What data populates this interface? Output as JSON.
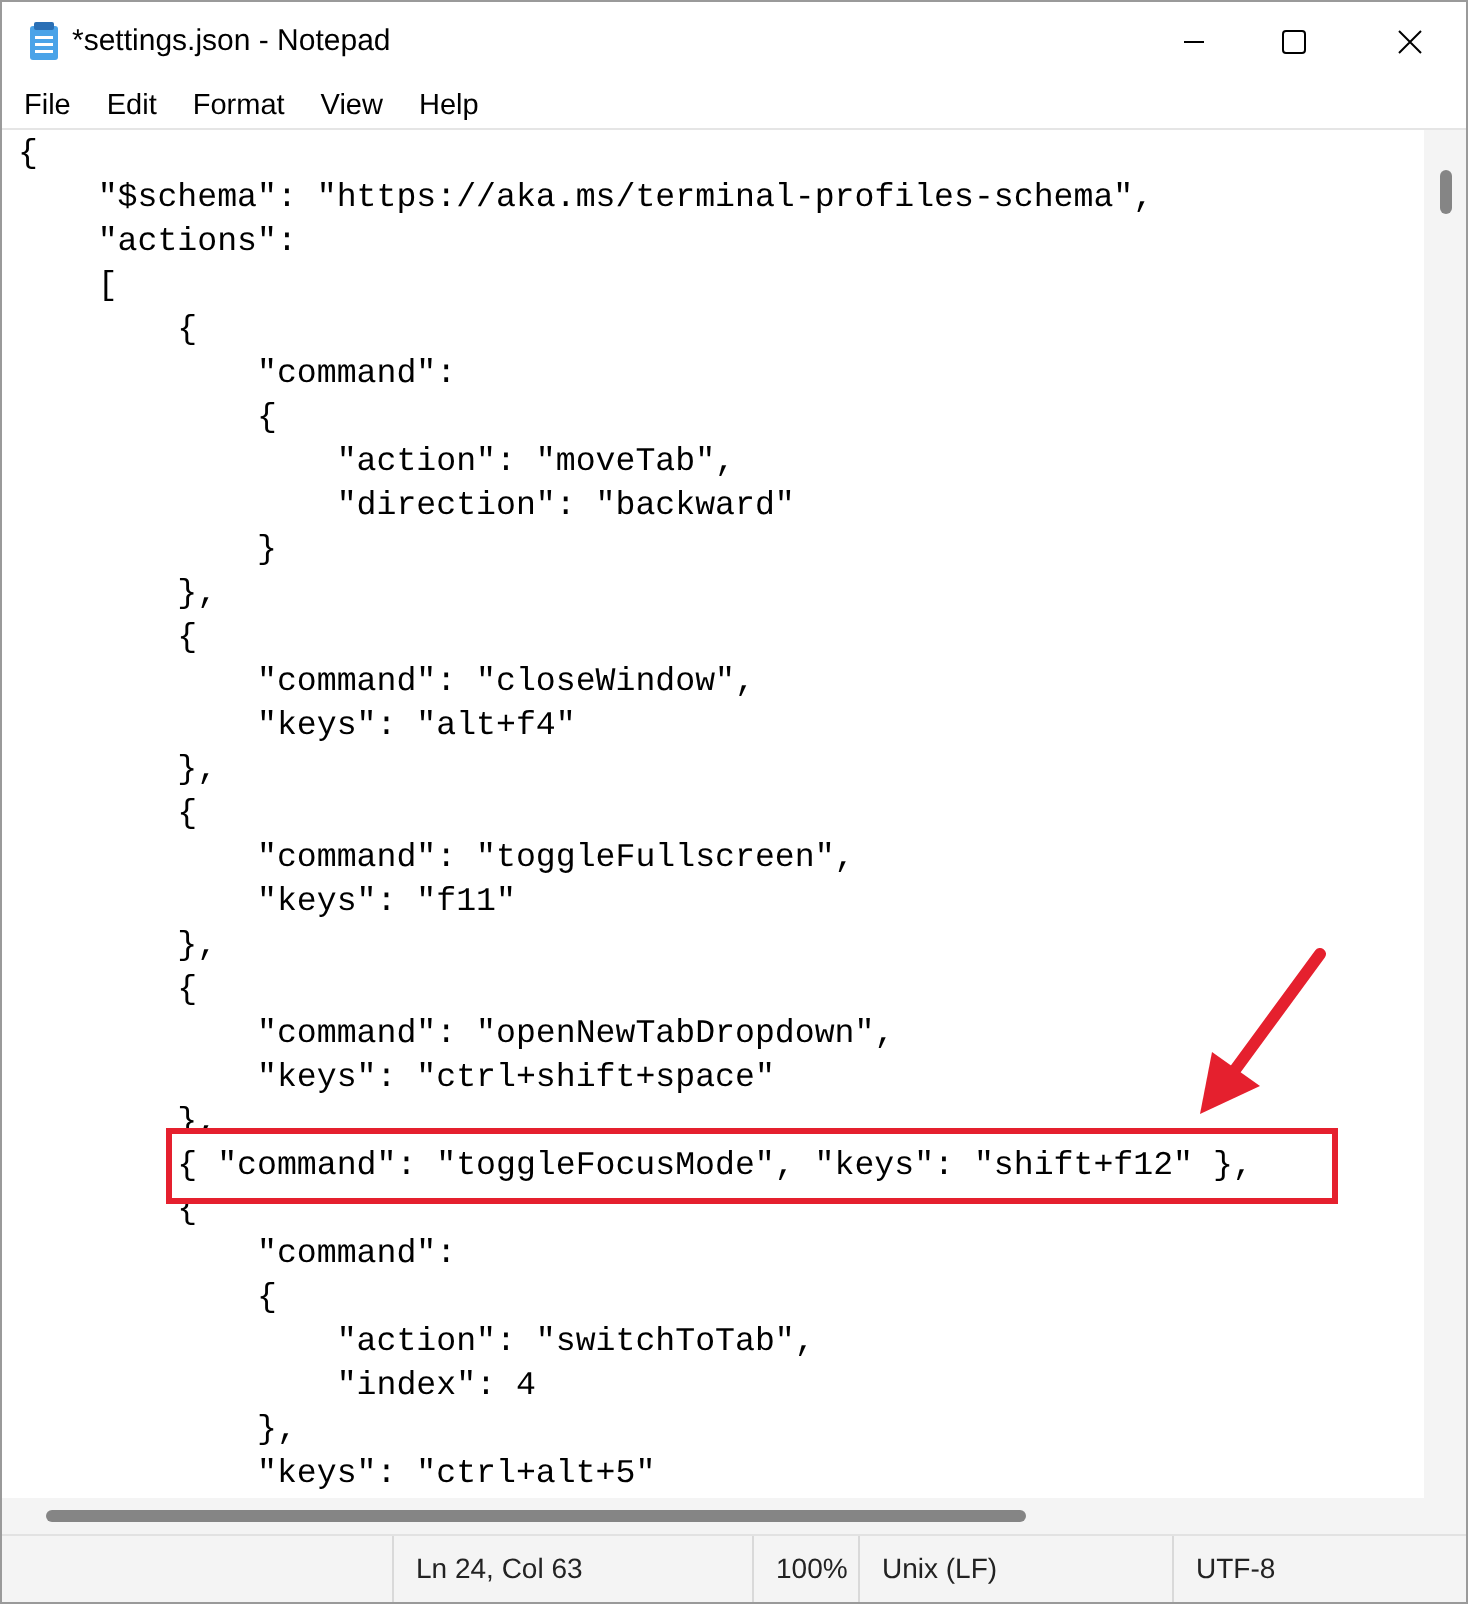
{
  "window": {
    "title": "*settings.json - Notepad"
  },
  "menu": [
    "File",
    "Edit",
    "Format",
    "View",
    "Help"
  ],
  "editor": {
    "lines": [
      {
        "text": "{",
        "kind": "plain"
      },
      {
        "text": "    \"$schema\": \"https://aka.ms/terminal-profiles-schema\",",
        "kind": "plain"
      },
      {
        "text": "    \"actions\":",
        "kind": "plain"
      },
      {
        "text": "    [",
        "kind": "plain"
      },
      {
        "text": "        {",
        "kind": "plain"
      },
      {
        "text": "            \"command\":",
        "kind": "plain"
      },
      {
        "text": "            {",
        "kind": "plain"
      },
      {
        "text": "                \"action\": \"moveTab\",",
        "kind": "plain"
      },
      {
        "text": "                \"direction\": \"backward\"",
        "kind": "plain"
      },
      {
        "text": "            }",
        "kind": "plain"
      },
      {
        "text": "        },",
        "kind": "plain"
      },
      {
        "text": "        {",
        "kind": "plain"
      },
      {
        "text": "            \"command\": \"closeWindow\",",
        "kind": "plain"
      },
      {
        "text": "            \"keys\": \"alt+f4\"",
        "kind": "plain"
      },
      {
        "text": "        },",
        "kind": "plain"
      },
      {
        "text": "        {",
        "kind": "plain"
      },
      {
        "text": "            \"command\": \"toggleFullscreen\",",
        "kind": "plain"
      },
      {
        "text": "            \"keys\": \"f11\"",
        "kind": "plain"
      },
      {
        "text": "        },",
        "kind": "plain"
      },
      {
        "text": "        {",
        "kind": "plain"
      },
      {
        "text": "            \"command\": \"openNewTabDropdown\",",
        "kind": "plain"
      },
      {
        "text": "            \"keys\": \"ctrl+shift+space\"",
        "kind": "plain"
      },
      {
        "text": "        },",
        "kind": "plain"
      },
      {
        "text": "        { \"command\": \"toggleFocusMode\", \"keys\": \"shift+f12\" },",
        "kind": "highlighted"
      },
      {
        "text": "        {",
        "kind": "plain"
      },
      {
        "text": "            \"command\":",
        "kind": "plain"
      },
      {
        "text": "            {",
        "kind": "plain"
      },
      {
        "text": "                \"action\": \"switchToTab\",",
        "kind": "plain"
      },
      {
        "text": "                \"index\": 4",
        "kind": "plain"
      },
      {
        "text": "            },",
        "kind": "plain"
      },
      {
        "text": "            \"keys\": \"ctrl+alt+5\"",
        "kind": "plain"
      }
    ]
  },
  "status_bar": [
    "Ln 24, Col 63",
    "100%",
    "Unix (LF)",
    "UTF-8"
  ]
}
